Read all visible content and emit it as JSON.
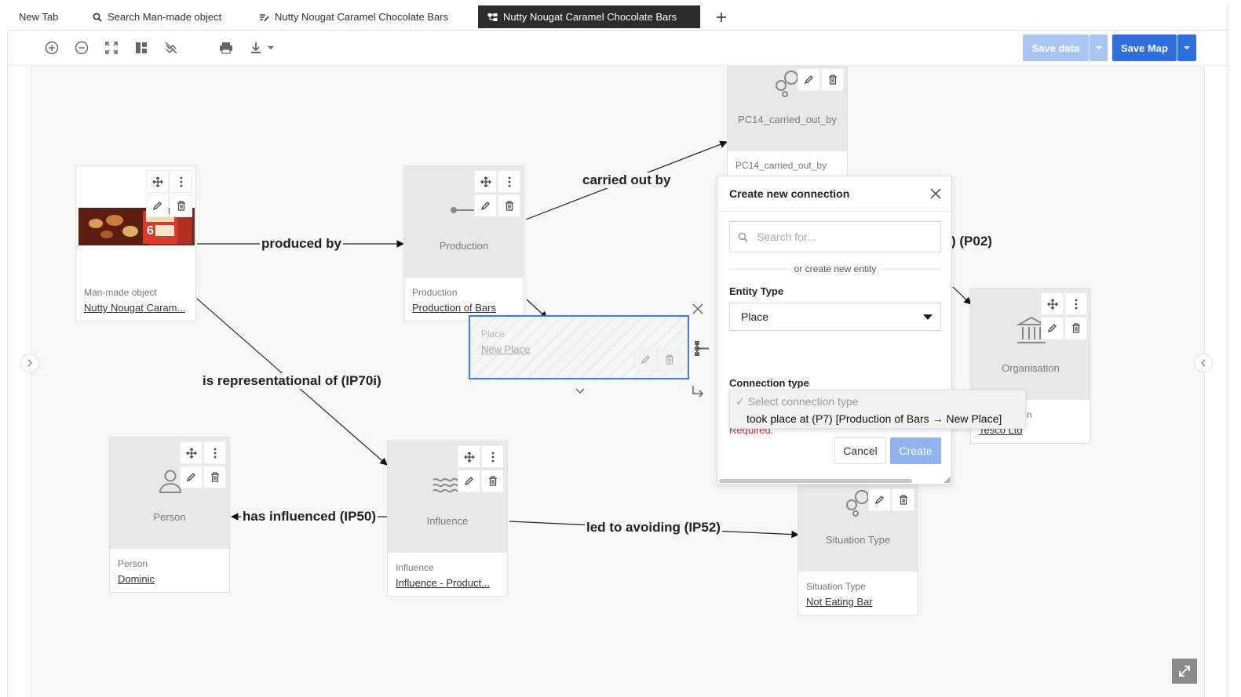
{
  "tabs": [
    {
      "label": "New Tab",
      "icon": "none",
      "active": false
    },
    {
      "label": "Search Man-made object",
      "icon": "search-icon",
      "active": false
    },
    {
      "label": "Nutty Nougat Caramel Chocolate Bars",
      "icon": "edit-list-icon",
      "active": false
    },
    {
      "label": "Nutty Nougat Caramel Chocolate Bars",
      "icon": "graph-icon",
      "active": true
    }
  ],
  "toolbar": {
    "save_data_label": "Save data",
    "save_map_label": "Save Map",
    "accent": "#2f6fdb",
    "accent_disabled": "#a9c5f2"
  },
  "edges": {
    "produced_by": "produced by",
    "carried_out_by": "carried out by",
    "is_representational_of": "is representational of (IP70i)",
    "has_influenced": "has influenced (IP50)",
    "led_to_avoiding": "led to avoiding (IP52)",
    "p02_partial": ") (P02)"
  },
  "nodes": {
    "manmade": {
      "caption": "Man-made object",
      "title": "Nutty Nougat Caram..."
    },
    "production": {
      "visual_label": "Production",
      "caption": "Production",
      "title": "Production of Bars"
    },
    "pc14": {
      "visual_label": "PC14_carried_out_by",
      "caption": "PC14_carried_out_by"
    },
    "organisation": {
      "visual_label": "Organisation",
      "caption_partial": "n",
      "title_partial": "Tesco Ltd"
    },
    "person": {
      "visual_label": "Person",
      "caption": "Person",
      "title": "Dominic"
    },
    "influence": {
      "visual_label": "Influence",
      "caption": "Influence",
      "title": "Influence - Product..."
    },
    "situation": {
      "visual_label": "Situation Type",
      "caption": "Situation Type",
      "title": "Not Eating Bar"
    }
  },
  "place_box": {
    "caption": "Place",
    "title": "New Place"
  },
  "dialog": {
    "title": "Create new connection",
    "search_placeholder": "Search for...",
    "or_create": "or create new entity",
    "entity_type_label": "Entity Type",
    "entity_type_value": "Place",
    "connection_type_label": "Connection type",
    "required_text": "Required.",
    "cancel_label": "Cancel",
    "create_label": "Create",
    "dropdown_options": [
      "✓ Select connection type",
      "took place at (P7) [Production of Bars → New Place]"
    ]
  }
}
